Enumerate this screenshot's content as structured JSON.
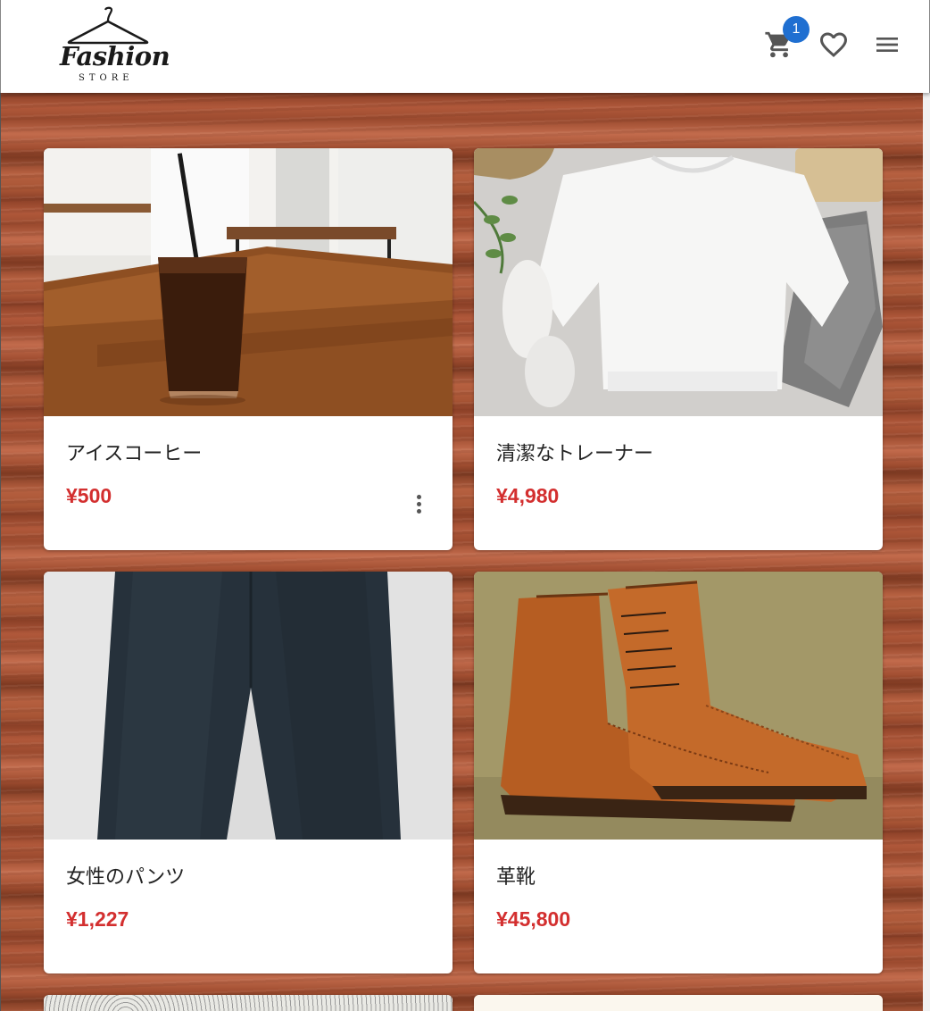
{
  "header": {
    "logo_main": "Fashion",
    "logo_sub": "STORE",
    "cart_icon": "cart-icon",
    "cart_count": "1",
    "favorite_icon": "heart-outline-icon",
    "menu_icon": "hamburger-menu-icon"
  },
  "products": [
    {
      "name": "アイスコーヒー",
      "price": "¥500",
      "image": "iced-coffee-photo",
      "has_more_menu": true
    },
    {
      "name": "清潔なトレーナー",
      "price": "¥4,980",
      "image": "white-sweatshirt-photo"
    },
    {
      "name": "女性のパンツ",
      "price": "¥1,227",
      "image": "navy-pants-photo"
    },
    {
      "name": "革靴",
      "price": "¥45,800",
      "image": "leather-boots-photo"
    }
  ],
  "colors": {
    "price": "#d32f2f",
    "badge": "#1f6fd1",
    "background": "wood-texture"
  }
}
